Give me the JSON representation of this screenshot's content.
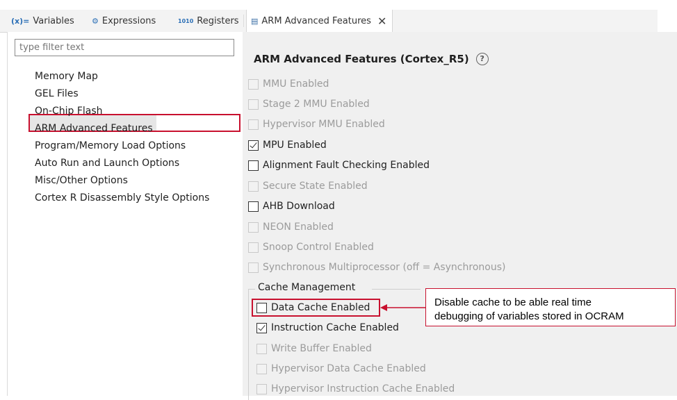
{
  "tabs": [
    {
      "icon": "(x)=",
      "label": "Variables"
    },
    {
      "icon": "⚙",
      "label": "Expressions"
    },
    {
      "icon": "1010",
      "label": "Registers"
    },
    {
      "icon": "▤",
      "label": "ARM Advanced Features",
      "active": true,
      "close": "✕"
    }
  ],
  "filter": {
    "placeholder": "type filter text"
  },
  "nav": [
    "Memory Map",
    "GEL Files",
    "On-Chip Flash",
    "ARM Advanced Features",
    "Program/Memory Load Options",
    "Auto Run and Launch Options",
    "Misc/Other Options",
    "Cortex R Disassembly Style Options"
  ],
  "main": {
    "title": "ARM Advanced Features (Cortex_R5)",
    "help": "?",
    "options": [
      {
        "label": "MMU Enabled",
        "checked": false,
        "enabled": false
      },
      {
        "label": "Stage 2 MMU Enabled",
        "checked": false,
        "enabled": false
      },
      {
        "label": "Hypervisor MMU Enabled",
        "checked": false,
        "enabled": false
      },
      {
        "label": "MPU Enabled",
        "checked": true,
        "enabled": true
      },
      {
        "label": "Alignment Fault Checking Enabled",
        "checked": false,
        "enabled": true
      },
      {
        "label": "Secure State Enabled",
        "checked": false,
        "enabled": false
      },
      {
        "label": "AHB Download",
        "checked": false,
        "enabled": true
      },
      {
        "label": "NEON Enabled",
        "checked": false,
        "enabled": false
      },
      {
        "label": "Snoop Control Enabled",
        "checked": false,
        "enabled": false
      },
      {
        "label": "Synchronous Multiprocessor (off = Asynchronous)",
        "checked": false,
        "enabled": false
      }
    ],
    "cache_group": {
      "legend": "Cache Management",
      "options": [
        {
          "label": "Data Cache Enabled",
          "checked": false,
          "enabled": true
        },
        {
          "label": "Instruction Cache Enabled",
          "checked": true,
          "enabled": true
        },
        {
          "label": "Write Buffer Enabled",
          "checked": false,
          "enabled": false
        },
        {
          "label": "Hypervisor Data Cache Enabled",
          "checked": false,
          "enabled": false
        },
        {
          "label": "Hypervisor Instruction Cache Enabled",
          "checked": false,
          "enabled": false
        }
      ]
    }
  },
  "callout": {
    "line1": "Disable cache to be able real time",
    "line2": "debugging of variables stored in OCRAM",
    "color": "#c8102e"
  }
}
